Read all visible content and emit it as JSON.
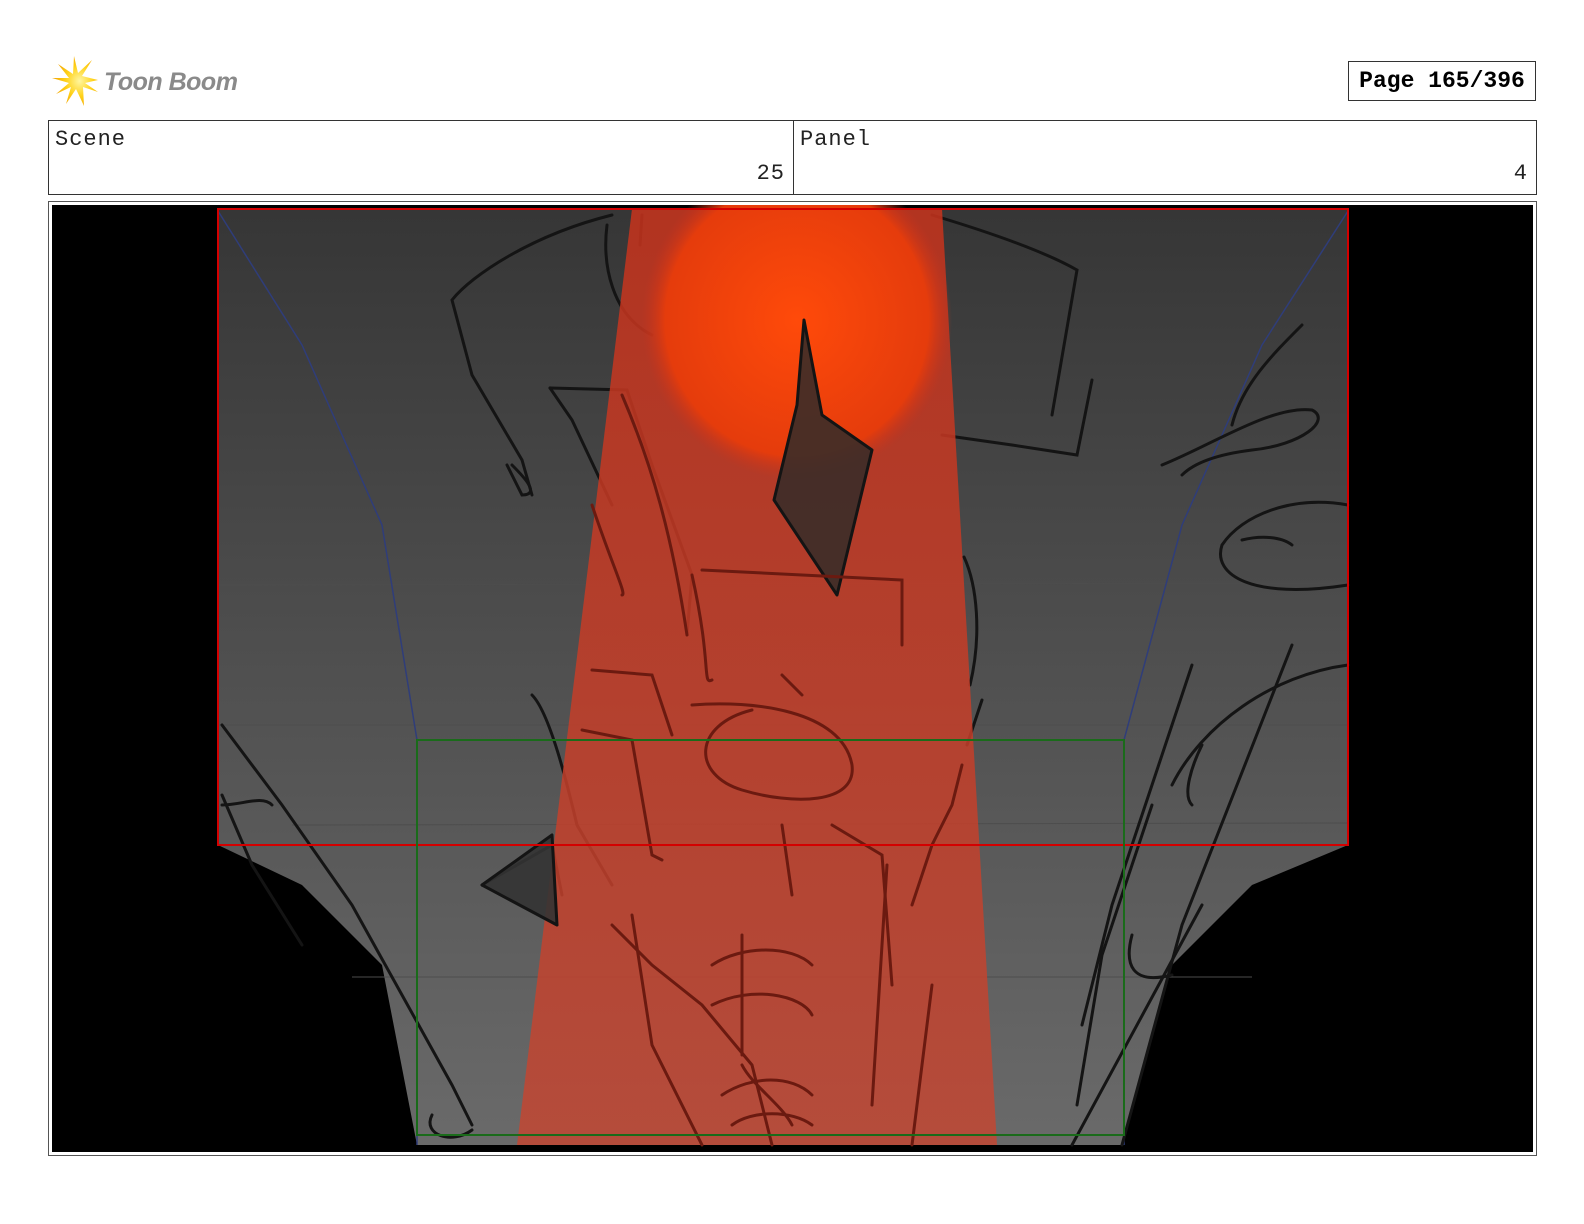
{
  "header": {
    "logo_text": "Toon Boom",
    "logo_icon": "starburst-icon",
    "page_label": "Page 165/396"
  },
  "info": {
    "scene_label": "Scene",
    "scene_value": "25",
    "panel_label": "Panel",
    "panel_value": "4"
  },
  "colors": {
    "camera_frame": "#cc0000",
    "safe_frame": "#1a6b1a",
    "light_beam": "#d9381e",
    "glow": "#ff4a10",
    "backdrop": "#000000"
  }
}
